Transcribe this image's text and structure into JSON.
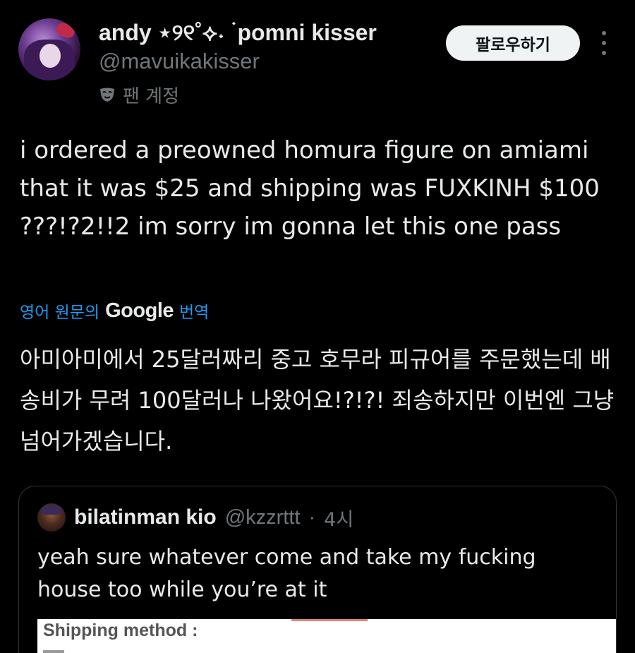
{
  "author": {
    "display_name": "andy ⋆୨୧˚⟡˖ ࣪ pomni kisser",
    "handle": "@mavuikakisser",
    "badge_label": "팬 계정",
    "badge_icon": "mask-icon"
  },
  "actions": {
    "follow_label": "팔로우하기",
    "more_icon": "more-icon"
  },
  "tweet": {
    "text": "i ordered a preowned homura figure on amiami that it was $25 and shipping was FUXKINH $100 ???!?2!!2 im sorry im gonna let this one pass"
  },
  "translation": {
    "prefix": "영어 원문의",
    "provider": "Google",
    "suffix": "번역",
    "text": "아미아미에서 25달러짜리 중고 호무라 피규어를 주문했는데 배송비가 무려 100달러나 나왔어요!?!?! 죄송하지만 이번엔 그냥 넘어가겠습니다."
  },
  "quoted_tweet": {
    "display_name": "bilatinman kio",
    "handle": "@kzzrttt",
    "separator": "·",
    "time": "4시",
    "text": "yeah sure whatever come and take my fucking house too while you’re at it",
    "image_text": "Shipping method :"
  },
  "colors": {
    "background": "#000000",
    "text_primary": "#e7e9ea",
    "text_secondary": "#71767b",
    "link": "#1d9bf0",
    "follow_button_bg": "#eff3f4",
    "border": "#333639"
  }
}
